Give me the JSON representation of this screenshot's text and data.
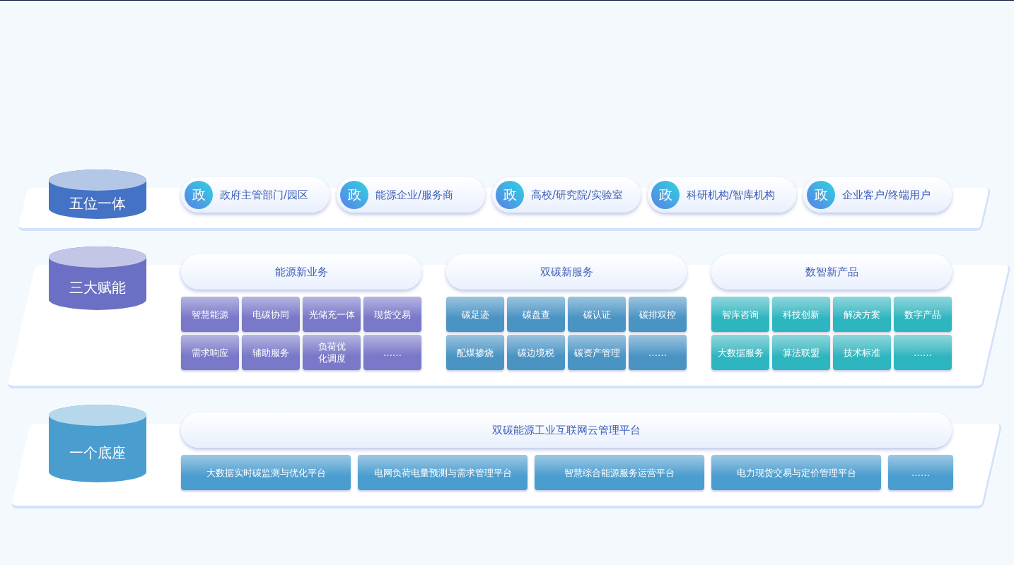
{
  "layers": [
    {
      "kind": "roles",
      "title": "五位一体",
      "color": "#4472c4",
      "items": [
        {
          "badge": "政",
          "label": "政府主管部门/园区"
        },
        {
          "badge": "政",
          "label": "能源企业/服务商"
        },
        {
          "badge": "政",
          "label": "高校/研究院/实验室"
        },
        {
          "badge": "政",
          "label": "科研机构/智库机构"
        },
        {
          "badge": "政",
          "label": "企业客户/终端用户"
        }
      ]
    },
    {
      "kind": "groups",
      "title": "三大赋能",
      "color": "#6b70c4",
      "groups": [
        {
          "title": "能源新业务",
          "color": "#7a78c8",
          "tiles": [
            "智慧能源",
            "电碳协同",
            "光储充一体",
            "现货交易",
            "需求响应",
            "辅助服务",
            "负荷优化调度",
            "……"
          ]
        },
        {
          "title": "双碳新服务",
          "color": "#4a94c4",
          "tiles": [
            "碳足迹",
            "碳盘查",
            "碳认证",
            "碳排双控",
            "配煤掺烧",
            "碳边境税",
            "碳资产管理",
            "……"
          ]
        },
        {
          "title": "数智新产品",
          "color": "#2eb6c0",
          "tiles": [
            "智库咨询",
            "科技创新",
            "解决方案",
            "数字产品",
            "大数据服务",
            "算法联盟",
            "技术标准",
            "……"
          ]
        }
      ]
    },
    {
      "kind": "platform",
      "title": "一个底座",
      "color": "#4a9dcf",
      "header": "双碳能源工业互联网云管理平台",
      "tiles": [
        "大数据实时碳监测与优化平台",
        "电网负荷电量预测与需求管理平台",
        "智慧综合能源服务运营平台",
        "电力现货交易与定价管理平台",
        "……"
      ]
    }
  ]
}
